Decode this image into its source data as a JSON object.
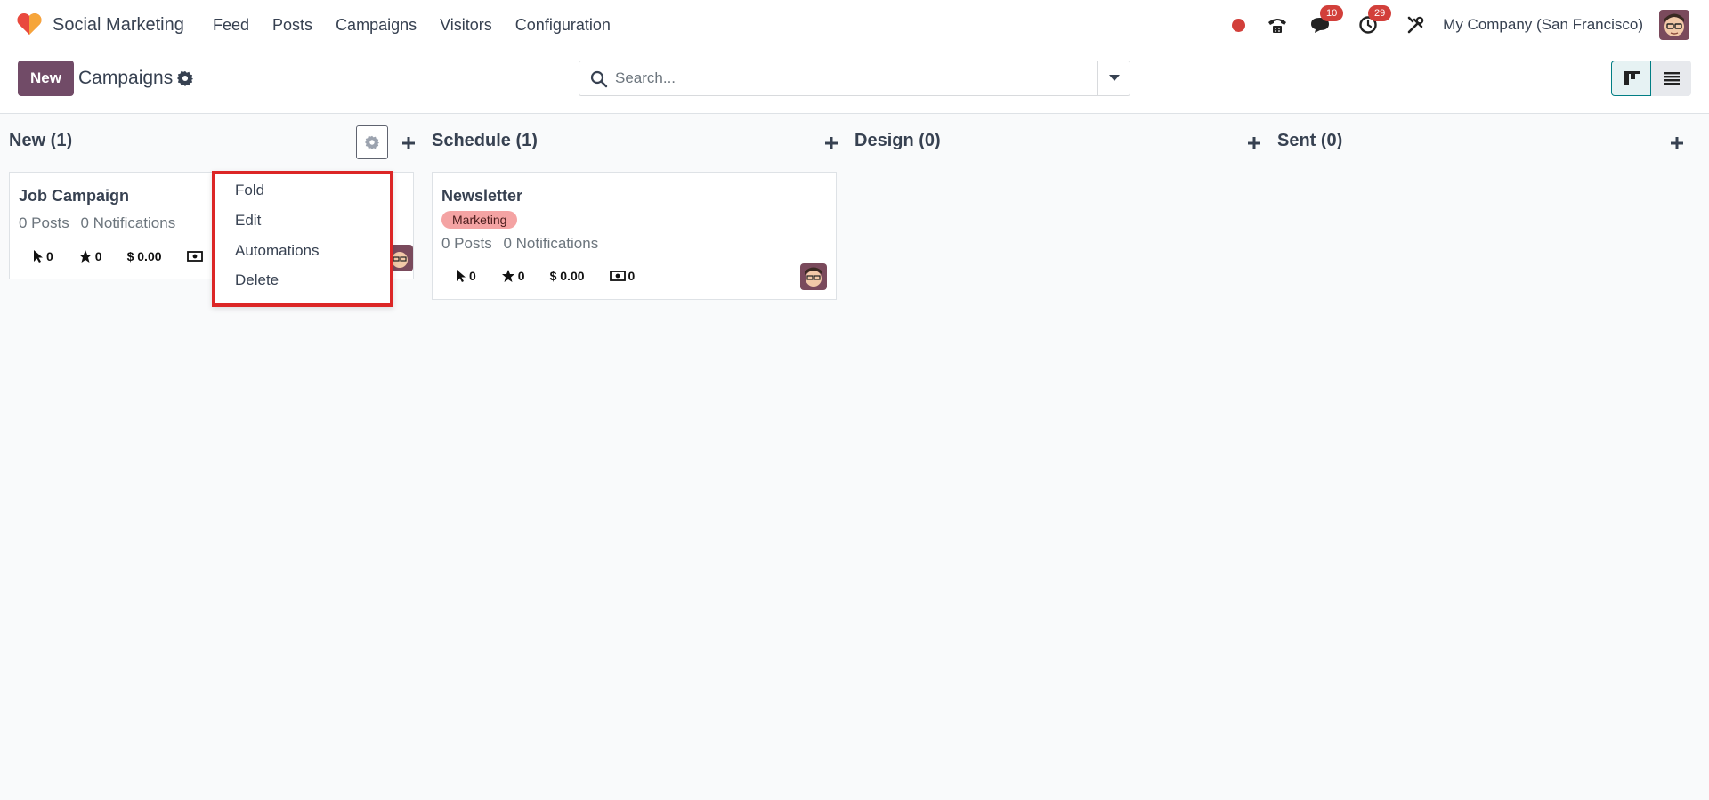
{
  "app": {
    "name": "Social Marketing",
    "menu": [
      "Feed",
      "Posts",
      "Campaigns",
      "Visitors",
      "Configuration"
    ],
    "brand_color": "#714b67"
  },
  "systray": {
    "messages_count": "10",
    "activities_count": "29",
    "company": "My Company (San Francisco)"
  },
  "control_panel": {
    "new_label": "New",
    "breadcrumb": "Campaigns",
    "search_placeholder": "Search..."
  },
  "columns": [
    {
      "title": "New (1)",
      "cards": [
        {
          "title": "Job Campaign",
          "posts": "0 Posts",
          "notifications": "0 Notifications",
          "clicks": "0",
          "favorites": "0",
          "revenue": "$ 0.00"
        }
      ]
    },
    {
      "title": "Schedule (1)",
      "cards": [
        {
          "title": "Newsletter",
          "tag": "Marketing",
          "posts": "0 Posts",
          "notifications": "0 Notifications",
          "clicks": "0",
          "favorites": "0",
          "revenue": "$ 0.00",
          "mailings": "0"
        }
      ]
    },
    {
      "title": "Design (0)",
      "cards": []
    },
    {
      "title": "Sent (0)",
      "cards": []
    }
  ],
  "column_menu": {
    "items": [
      "Fold",
      "Edit",
      "Automations",
      "Delete"
    ],
    "highlight_color": "#dc2626"
  }
}
